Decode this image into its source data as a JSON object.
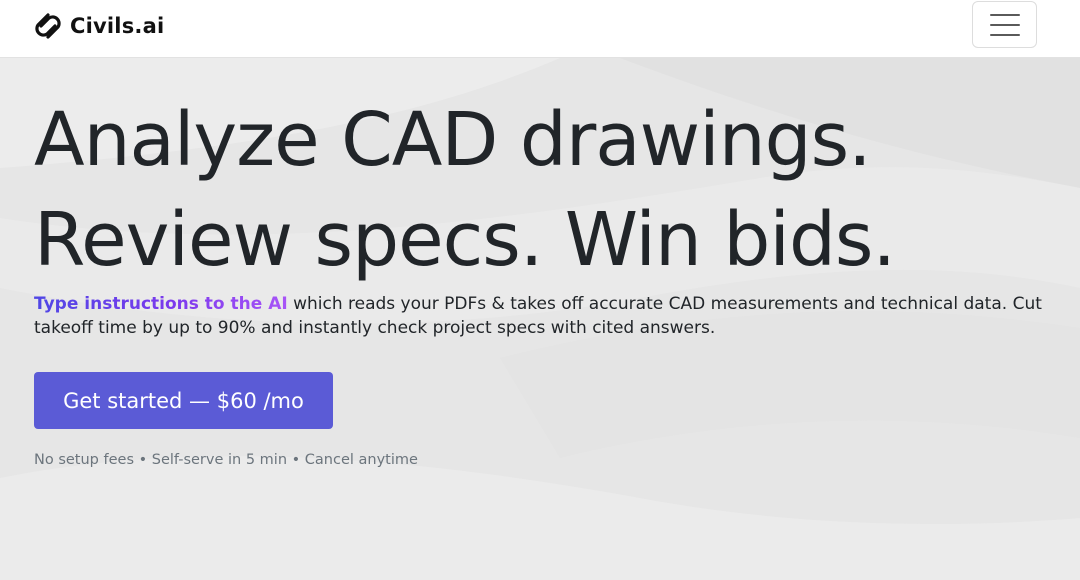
{
  "navbar": {
    "brand_name": "Civils.ai",
    "logo_icon": "civils-logo-icon",
    "menu_icon": "hamburger-menu-icon"
  },
  "hero": {
    "headline_line1": "Analyze CAD drawings.",
    "headline_line2": "Review specs. Win bids.",
    "lead_highlight": "Type instructions to the AI",
    "lead_rest": " which reads your PDFs & takes off accurate CAD measurements and technical data. Cut takeoff time by up to 90% and instantly check project specs with cited answers.",
    "cta_label": "Get started — $60 /mo",
    "fineprint": "No setup fees • Self-serve in 5 min • Cancel anytime"
  },
  "colors": {
    "cta_background": "#5b5bd6",
    "highlight_gradient_start": "#4f46e5",
    "highlight_gradient_end": "#a855f7",
    "hero_background": "#e7e7e7"
  }
}
